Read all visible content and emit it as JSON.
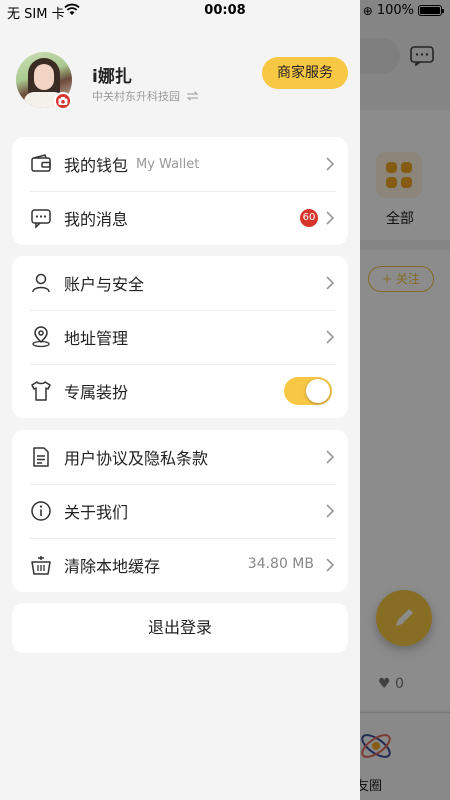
{
  "status_bar": {
    "carrier": "无 SIM 卡",
    "time": "00:08",
    "battery_percent": "100%"
  },
  "background": {
    "all_category_label": "全部",
    "follow_label": "+ 关注",
    "like_count": "0",
    "tab_partial_label": "友圈"
  },
  "profile": {
    "username": "i娜扎",
    "organization": "中关村东升科技园",
    "merchant_button": "商家服务"
  },
  "groups": [
    {
      "items": [
        {
          "label": "我的钱包",
          "sublabel": "My Wallet",
          "icon": "wallet-icon"
        },
        {
          "label": "我的消息",
          "badge": "60",
          "icon": "message-icon"
        }
      ]
    },
    {
      "items": [
        {
          "label": "账户与安全",
          "icon": "user-icon"
        },
        {
          "label": "地址管理",
          "icon": "location-icon"
        },
        {
          "label": "专属装扮",
          "toggle_on": true,
          "icon": "tshirt-icon"
        }
      ]
    },
    {
      "items": [
        {
          "label": "用户协议及隐私条款",
          "icon": "document-icon"
        },
        {
          "label": "关于我们",
          "icon": "info-icon"
        },
        {
          "label": "清除本地缓存",
          "value": "34.80 MB",
          "icon": "basket-icon"
        }
      ]
    }
  ],
  "logout_label": "退出登录",
  "colors": {
    "accent": "#f8c744",
    "badge_red": "#d9342b"
  }
}
